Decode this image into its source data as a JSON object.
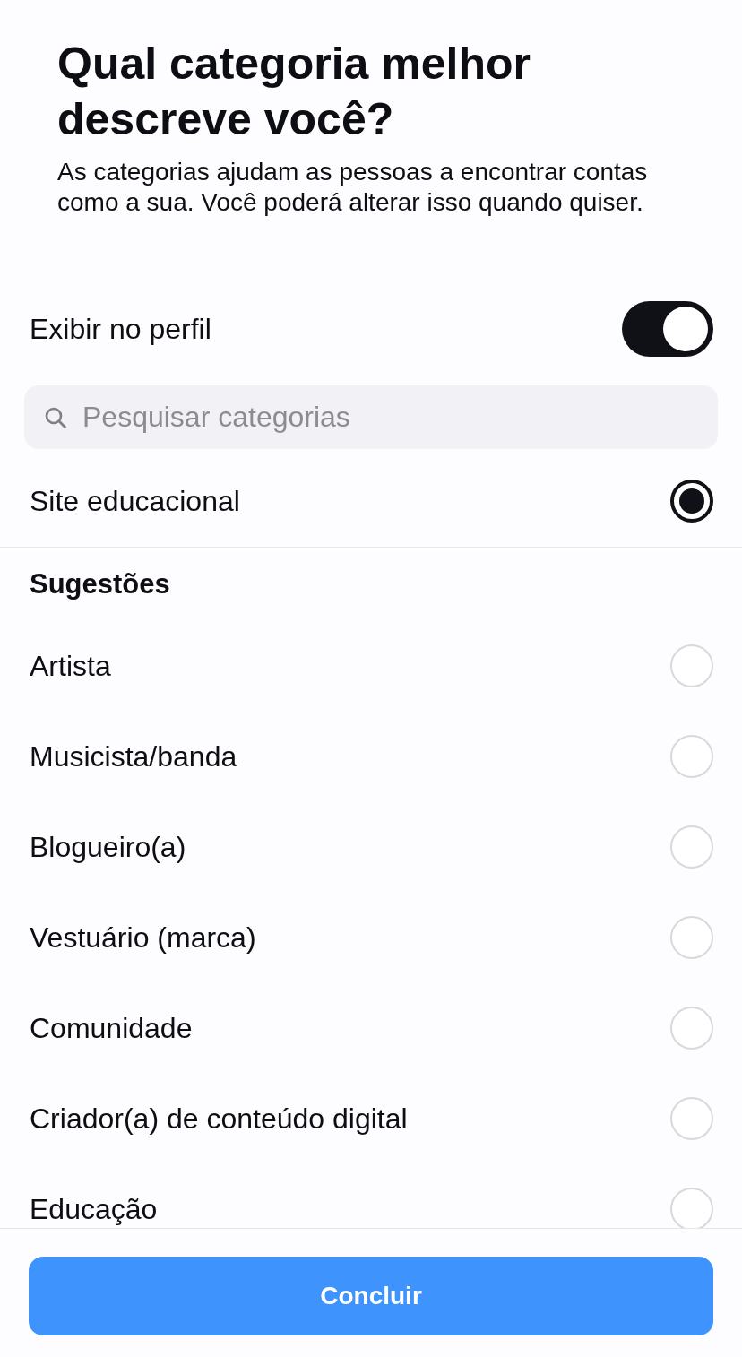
{
  "header": {
    "title": "Qual categoria melhor descreve você?",
    "description": "As categorias ajudam as pessoas a encontrar contas como a sua. Você poderá alterar isso quando quiser."
  },
  "show_on_profile": {
    "label": "Exibir no perfil",
    "on": true
  },
  "search": {
    "placeholder": "Pesquisar categorias"
  },
  "current_category": {
    "label": "Site educacional",
    "selected": true
  },
  "suggestions": {
    "heading": "Sugestões",
    "items": [
      {
        "label": "Artista",
        "selected": false
      },
      {
        "label": "Musicista/banda",
        "selected": false
      },
      {
        "label": "Blogueiro(a)",
        "selected": false
      },
      {
        "label": "Vestuário (marca)",
        "selected": false
      },
      {
        "label": "Comunidade",
        "selected": false
      },
      {
        "label": "Criador(a) de conteúdo digital",
        "selected": false
      },
      {
        "label": "Educação",
        "selected": false
      }
    ]
  },
  "footer": {
    "button": "Concluir"
  }
}
